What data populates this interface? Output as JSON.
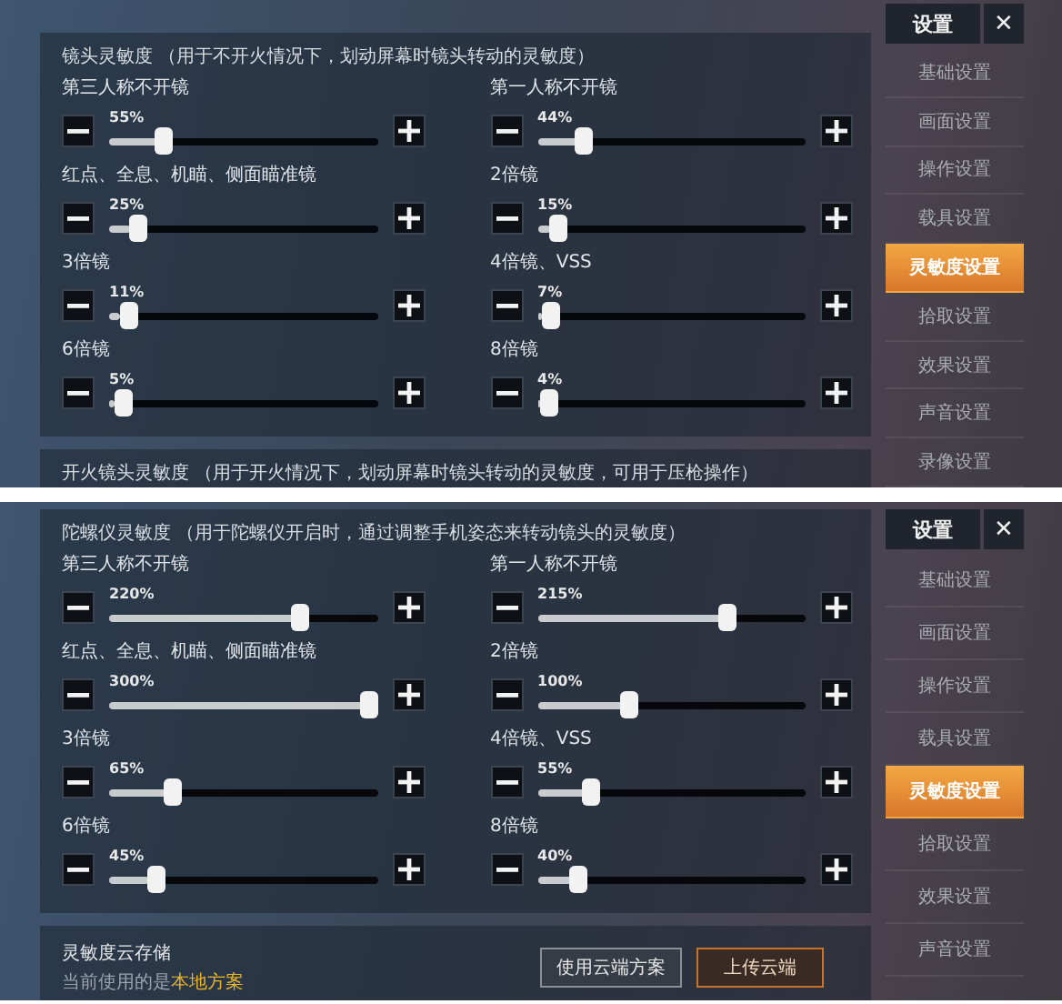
{
  "screens": [
    {
      "section": {
        "title": "镜头灵敏度 （用于不开火情况下，划动屏幕时镜头转动的灵敏度）",
        "sliders": [
          {
            "label": "第三人称不开镜",
            "reading": "55%",
            "level": 0.18
          },
          {
            "label": "第一人称不开镜",
            "reading": "44%",
            "level": 0.15
          },
          {
            "label": "红点、全息、机瞄、侧面瞄准镜",
            "reading": "25%",
            "level": 0.08
          },
          {
            "label": "2倍镜",
            "reading": "15%",
            "level": 0.05
          },
          {
            "label": "3倍镜",
            "reading": "11%",
            "level": 0.04
          },
          {
            "label": "4倍镜、VSS",
            "reading": "7%",
            "level": 0.02
          },
          {
            "label": "6倍镜",
            "reading": "5%",
            "level": 0.02
          },
          {
            "label": "8倍镜",
            "reading": "4%",
            "level": 0.01
          }
        ]
      },
      "next_section_title": "开火镜头灵敏度 （用于开火情况下，划动屏幕时镜头转动的灵敏度，可用于压枪操作）",
      "sidebar": {
        "title": "设置",
        "close": "✕",
        "items": [
          {
            "label": "基础设置",
            "selected": false
          },
          {
            "label": "画面设置",
            "selected": false
          },
          {
            "label": "操作设置",
            "selected": false
          },
          {
            "label": "载具设置",
            "selected": false
          },
          {
            "label": "灵敏度设置",
            "selected": true
          },
          {
            "label": "拾取设置",
            "selected": false
          },
          {
            "label": "效果设置",
            "selected": false
          },
          {
            "label": "声音设置",
            "selected": false
          },
          {
            "label": "录像设置",
            "selected": false
          }
        ]
      }
    },
    {
      "section": {
        "title": "陀螺仪灵敏度 （用于陀螺仪开启时，通过调整手机姿态来转动镜头的灵敏度）",
        "sliders": [
          {
            "label": "第三人称不开镜",
            "reading": "220%",
            "level": 0.73
          },
          {
            "label": "第一人称不开镜",
            "reading": "215%",
            "level": 0.72
          },
          {
            "label": "红点、全息、机瞄、侧面瞄准镜",
            "reading": "300%",
            "level": 1
          },
          {
            "label": "2倍镜",
            "reading": "100%",
            "level": 0.33
          },
          {
            "label": "3倍镜",
            "reading": "65%",
            "level": 0.22
          },
          {
            "label": "4倍镜、VSS",
            "reading": "55%",
            "level": 0.18
          },
          {
            "label": "6倍镜",
            "reading": "45%",
            "level": 0.15
          },
          {
            "label": "8倍镜",
            "reading": "40%",
            "level": 0.13
          }
        ]
      },
      "cloud": {
        "title": "灵敏度云存储",
        "status": "当前使用的是",
        "plan": "本地方案",
        "buttons": [
          {
            "label": "使用云端方案",
            "kind": "secondary"
          },
          {
            "label": "上传云端",
            "kind": "primary"
          }
        ]
      },
      "sidebar": {
        "title": "设置",
        "close": "✕",
        "items": [
          {
            "label": "基础设置",
            "selected": false
          },
          {
            "label": "画面设置",
            "selected": false
          },
          {
            "label": "操作设置",
            "selected": false
          },
          {
            "label": "载具设置",
            "selected": false
          },
          {
            "label": "灵敏度设置",
            "selected": true
          },
          {
            "label": "拾取设置",
            "selected": false
          },
          {
            "label": "效果设置",
            "selected": false
          },
          {
            "label": "声音设置",
            "selected": false
          }
        ]
      }
    }
  ]
}
